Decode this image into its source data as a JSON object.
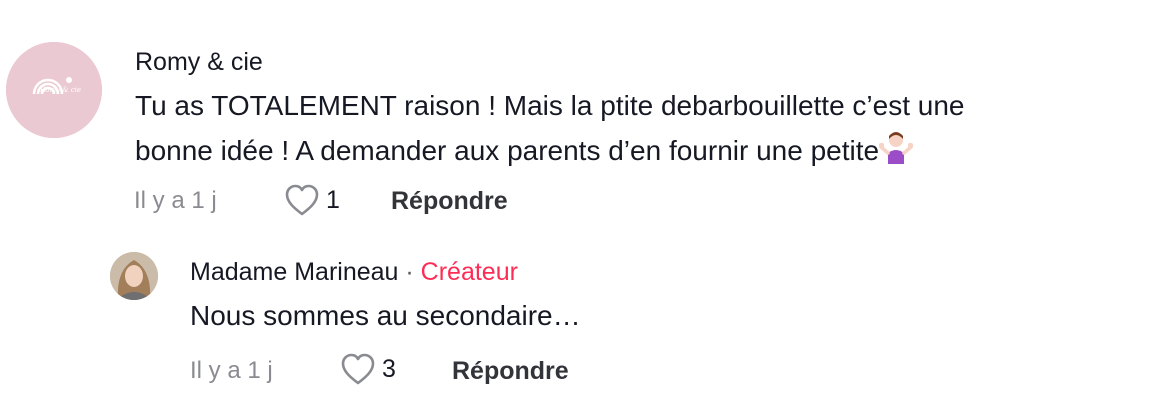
{
  "comments": [
    {
      "username": "Romy & cie",
      "avatar_text": "Romy & cie",
      "text_line1": "Tu as TOTALEMENT raison ! Mais la ptite debarbouillette c’est une",
      "text_line2": "bonne idée ! A demander aux parents d’en fournir une petite",
      "time": "Il y a 1 j",
      "likes": "1",
      "reply_label": "Répondre"
    }
  ],
  "reply": {
    "username": "Madame Marineau",
    "separator": "·",
    "badge": "Créateur",
    "text": "Nous sommes au secondaire…",
    "time": "Il y a 1 j",
    "likes": "3",
    "reply_label": "Répondre"
  },
  "colors": {
    "accent": "#fe2c55",
    "muted": "#8a8b91",
    "avatar_pink": "#ebc9d2"
  },
  "icons": [
    "heart-outline-icon",
    "shrug-emoji-icon"
  ]
}
